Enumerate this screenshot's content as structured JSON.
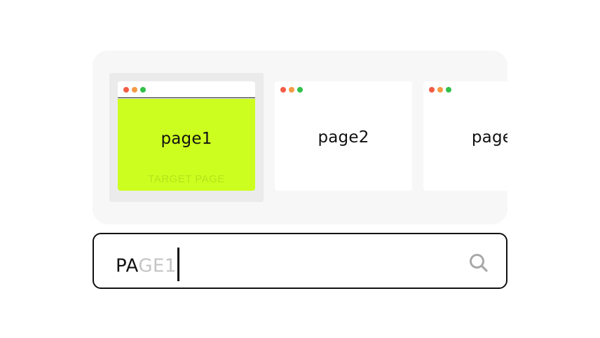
{
  "colors": {
    "dot_red": "#f25c45",
    "dot_orange": "#f59a45",
    "dot_green": "#33c04a",
    "target_bg": "#ccff1f",
    "tab_strip_bg": "#f7f7f7",
    "selected_frame_bg": "#ebebeb"
  },
  "tabs": [
    {
      "label": "page1",
      "badge": "TARGET PAGE",
      "selected": true
    },
    {
      "label": "page2",
      "selected": false
    },
    {
      "label": "page",
      "selected": false
    }
  ],
  "search": {
    "typed": "PA",
    "suggestion": "GE1",
    "icon": "search-icon"
  }
}
